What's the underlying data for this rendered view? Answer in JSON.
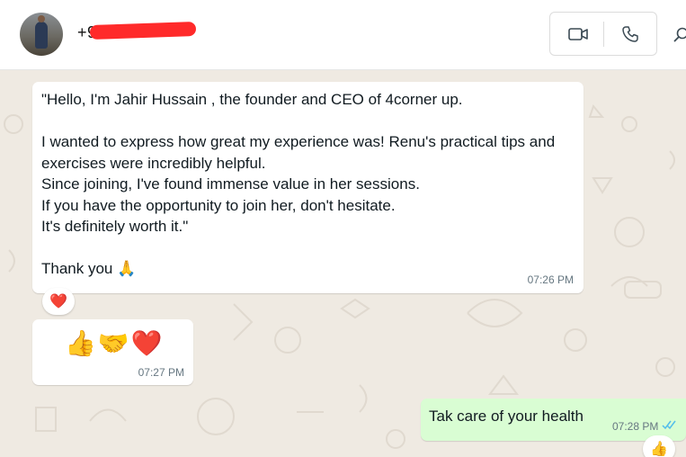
{
  "header": {
    "contact_number": "+9",
    "video_call_icon": "video-camera-icon",
    "voice_call_icon": "phone-icon",
    "search_icon": "search-icon"
  },
  "messages": [
    {
      "direction": "incoming",
      "text": "\"Hello, I'm Jahir Hussain , the founder and CEO of 4corner up.\n\nI wanted to express how great my experience was! Renu's practical tips and\nexercises were incredibly helpful.\nSince joining, I've found immense value in her sessions.\nIf you have the opportunity to join her, don't hesitate.\nIt's definitely worth it.\"\n\nThank you 🙏",
      "time": "07:26 PM",
      "reaction": "❤️"
    },
    {
      "direction": "incoming",
      "emojis": [
        "👍",
        "🤝",
        "❤️"
      ],
      "time": "07:27 PM"
    },
    {
      "direction": "outgoing",
      "text": "Tak care of your health",
      "time": "07:28 PM",
      "status": "read",
      "reaction": "👍"
    }
  ],
  "colors": {
    "chat_background": "#efeae2",
    "outgoing_bubble": "#d9fdd3",
    "incoming_bubble": "#ffffff",
    "read_ticks": "#53bdeb"
  }
}
